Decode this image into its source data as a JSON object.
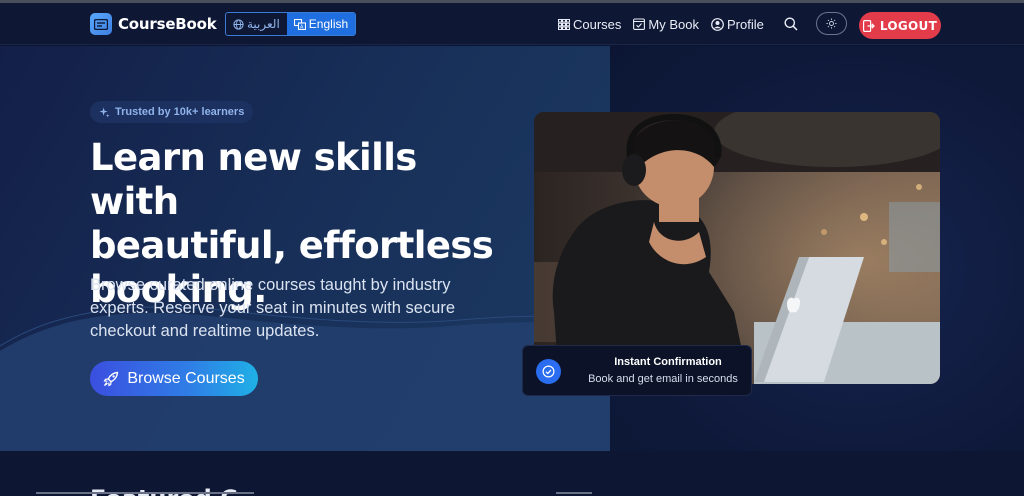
{
  "brand": {
    "name": "CourseBook"
  },
  "lang": {
    "arabic": "العربية",
    "english": "English"
  },
  "nav": {
    "courses": "Courses",
    "mybook": "My Book",
    "profile": "Profile",
    "logout": "LOGOUT"
  },
  "hero": {
    "badge": "Trusted by 10k+ learners",
    "headline_1": "Learn new skills with",
    "headline_2": "beautiful, effortless",
    "headline_3": "booking.",
    "subtext": "Browse curated online courses taught by industry experts. Reserve your seat in minutes with secure checkout and realtime updates.",
    "cta": "Browse Courses"
  },
  "confirm": {
    "title": "Instant Confirmation",
    "subtitle": "Book and get email in seconds"
  },
  "section": {
    "title": "Featured C"
  },
  "colors": {
    "accent": "#1f6fe0",
    "logout": "#e23b4a",
    "background": "#0b1430"
  },
  "icons": [
    "card-icon",
    "globe-icon",
    "translate-icon",
    "grid-icon",
    "book-check-icon",
    "user-circle-icon",
    "search-icon",
    "sun-icon",
    "logout-icon",
    "sparkle-icon",
    "rocket-icon",
    "check-badge-icon"
  ]
}
